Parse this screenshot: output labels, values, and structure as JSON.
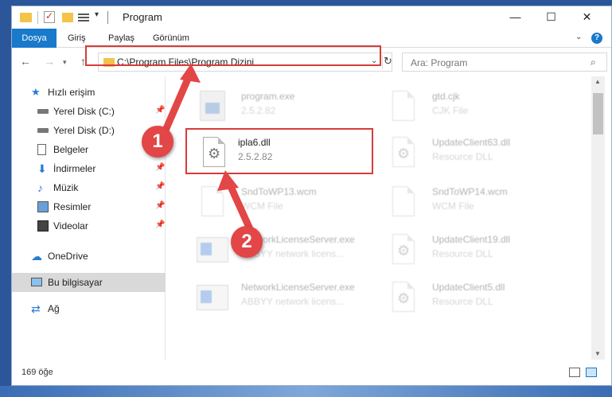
{
  "window": {
    "title": "Program"
  },
  "ribbon": {
    "tabs": [
      {
        "label": "Dosya"
      },
      {
        "label": "Giriş"
      },
      {
        "label": "Paylaş"
      },
      {
        "label": "Görünüm"
      }
    ]
  },
  "nav": {
    "address": "C:\\Program Files\\Program Dizini",
    "search_placeholder": "Ara: Program"
  },
  "sidebar": {
    "items": [
      {
        "label": "Hızlı erişim",
        "icon": "star-icon"
      },
      {
        "label": "Yerel Disk (C:)",
        "icon": "drive-icon",
        "pinned": true
      },
      {
        "label": "Yerel Disk (D:)",
        "icon": "drive-icon"
      },
      {
        "label": "Belgeler",
        "icon": "documents-icon"
      },
      {
        "label": "İndirmeler",
        "icon": "downloads-icon",
        "pinned": true
      },
      {
        "label": "Müzik",
        "icon": "music-icon",
        "pinned": true
      },
      {
        "label": "Resimler",
        "icon": "pictures-icon",
        "pinned": true
      },
      {
        "label": "Videolar",
        "icon": "videos-icon",
        "pinned": true
      },
      {
        "label": "OneDrive",
        "icon": "cloud-icon"
      },
      {
        "label": "Bu bilgisayar",
        "icon": "computer-icon",
        "selected": true
      },
      {
        "label": "Ağ",
        "icon": "network-icon"
      }
    ]
  },
  "files": [
    {
      "name": "program.exe",
      "meta": "2.5.2.82",
      "type": "exe",
      "highlighted": false
    },
    {
      "name": "gtd.cjk",
      "meta": "CJK File",
      "type": "doc",
      "highlighted": false
    },
    {
      "name": "ipla6.dll",
      "meta": "2.5.2.82",
      "type": "dll",
      "highlighted": true
    },
    {
      "name": "UpdateClient63.dll",
      "meta": "Resource DLL",
      "type": "dll",
      "highlighted": false
    },
    {
      "name": "SndToWP13.wcm",
      "meta": "WCM File",
      "type": "doc",
      "highlighted": false
    },
    {
      "name": "SndToWP14.wcm",
      "meta": "WCM File",
      "type": "doc",
      "highlighted": false
    },
    {
      "name": "NetworkLicenseServer.exe",
      "meta": "ABBYY network licens...",
      "type": "app",
      "highlighted": false
    },
    {
      "name": "UpdateClient19.dll",
      "meta": "Resource DLL",
      "type": "dll",
      "highlighted": false
    },
    {
      "name": "NetworkLicenseServer.exe",
      "meta": "ABBYY network licens...",
      "type": "app",
      "highlighted": false
    },
    {
      "name": "UpdateClient5.dll",
      "meta": "Resource DLL",
      "type": "dll",
      "highlighted": false
    }
  ],
  "status": {
    "count": "169 öğe"
  },
  "callouts": [
    {
      "number": "1"
    },
    {
      "number": "2"
    }
  ],
  "colors": {
    "accent": "#1979ca",
    "highlight": "#d83b3b",
    "callout": "#e24646"
  }
}
